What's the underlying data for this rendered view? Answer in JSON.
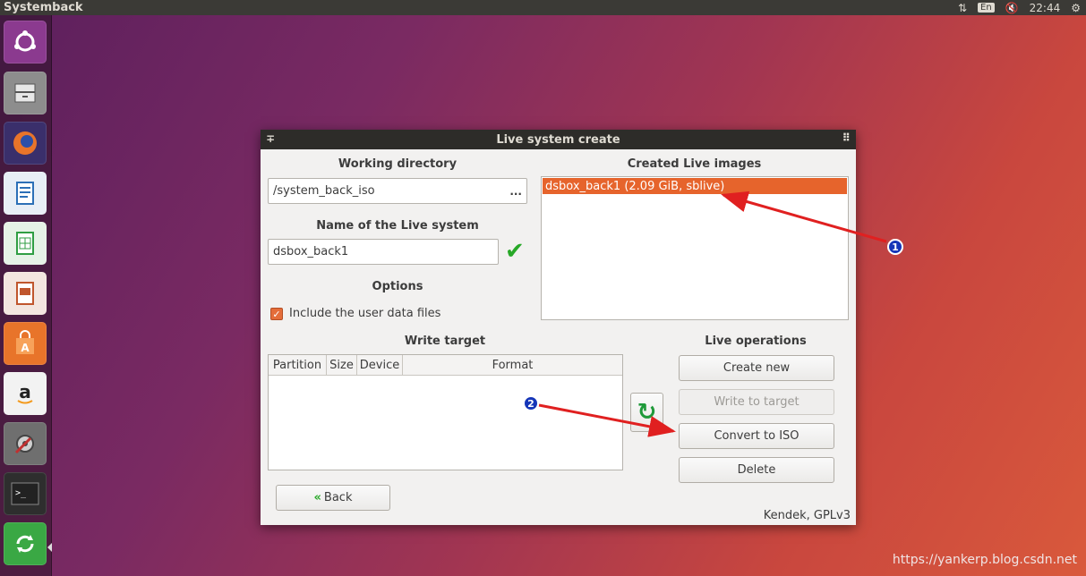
{
  "topbar": {
    "app_title": "Systemback",
    "keyboard_layout": "En",
    "clock": "22:44"
  },
  "launcher": {
    "items": [
      {
        "name": "ubuntu-dash",
        "icon": "ubuntu-icon",
        "color": "#8b3a8f"
      },
      {
        "name": "files",
        "icon": "file-cabinet-icon",
        "color": "#9a9a9a"
      },
      {
        "name": "firefox",
        "icon": "firefox-icon",
        "color": "#e8742a"
      },
      {
        "name": "writer",
        "icon": "document-icon",
        "color": "#2c6fb7"
      },
      {
        "name": "calc",
        "icon": "spreadsheet-icon",
        "color": "#2f9e43"
      },
      {
        "name": "impress",
        "icon": "presentation-icon",
        "color": "#c0562d"
      },
      {
        "name": "software",
        "icon": "shopping-bag-icon",
        "color": "#e8742a"
      },
      {
        "name": "amazon",
        "icon": "amazon-icon",
        "color": "#f0f0f0"
      },
      {
        "name": "settings",
        "icon": "wrench-gear-icon",
        "color": "#7b7b7b"
      },
      {
        "name": "terminal",
        "icon": "terminal-icon",
        "color": "#333333"
      },
      {
        "name": "systemback",
        "icon": "recycle-icon",
        "color": "#3aa844"
      }
    ]
  },
  "window": {
    "title": "Live system create",
    "working_directory": {
      "label": "Working directory",
      "value": "/system_back_iso",
      "browse": "..."
    },
    "live_name": {
      "label": "Name of the Live system",
      "value": "dsbox_back1"
    },
    "options": {
      "label": "Options",
      "include_user_data": "Include the user data files"
    },
    "created_images": {
      "label": "Created Live images",
      "items": [
        "dsbox_back1 (2.09 GiB, sblive)"
      ]
    },
    "write_target": {
      "label": "Write target",
      "columns": [
        "Partition",
        "Size",
        "Device",
        "Format"
      ]
    },
    "live_operations": {
      "label": "Live operations",
      "create_new": "Create new",
      "write_to_target": "Write to target",
      "convert_to_iso": "Convert to ISO",
      "delete": "Delete"
    },
    "back_button": "Back",
    "footer": "Kendek, GPLv3"
  },
  "annotations": [
    "1",
    "2"
  ],
  "watermark": "https://yankerp.blog.csdn.net",
  "colors": {
    "selection": "#e6642c",
    "accent_green": "#27a827",
    "annotation_arrow": "#e02020",
    "annotation_badge": "#1636b8"
  }
}
